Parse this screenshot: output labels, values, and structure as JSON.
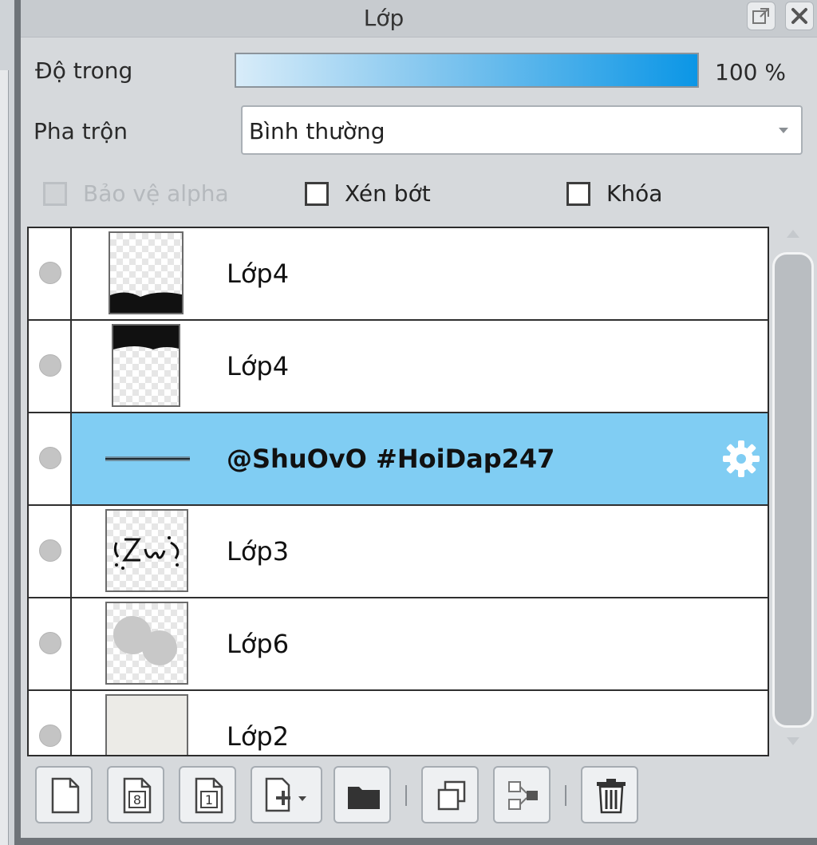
{
  "panel": {
    "title": "Lớp"
  },
  "opacity": {
    "label": "Độ trong",
    "value_text": "100 %",
    "value_percent": 100
  },
  "blend": {
    "label": "Pha trộn",
    "selected": "Bình thường"
  },
  "options": {
    "protect_alpha": {
      "label": "Bảo vệ alpha",
      "checked": false,
      "enabled": false
    },
    "clipping": {
      "label": "Xén bớt",
      "checked": false,
      "enabled": true
    },
    "lock": {
      "label": "Khóa",
      "checked": false,
      "enabled": true
    }
  },
  "layers": [
    {
      "name": "Lớp4",
      "selected": false,
      "thumbnail": "black-band-bottom"
    },
    {
      "name": "Lớp4",
      "selected": false,
      "thumbnail": "black-band-top"
    },
    {
      "name": "@ShuOvO #HoiDap247",
      "selected": true,
      "thumbnail": "text-layer",
      "icon": "gear-icon"
    },
    {
      "name": "Lớp3",
      "selected": false,
      "thumbnail": "sketch"
    },
    {
      "name": "Lớp6",
      "selected": false,
      "thumbnail": "gray-blobs"
    },
    {
      "name": "Lớp2",
      "selected": false,
      "thumbnail": "texture"
    }
  ],
  "toolbar": {
    "buttons": [
      "new-layer-icon",
      "new-8bit-layer-icon",
      "new-1bit-layer-icon",
      "add-layer-dropdown-icon",
      "new-folder-icon",
      "duplicate-layer-icon",
      "merge-down-icon",
      "delete-layer-icon"
    ]
  },
  "colors": {
    "selection": "#80cdf3",
    "opacity_bar_end": "#0b96e6"
  }
}
